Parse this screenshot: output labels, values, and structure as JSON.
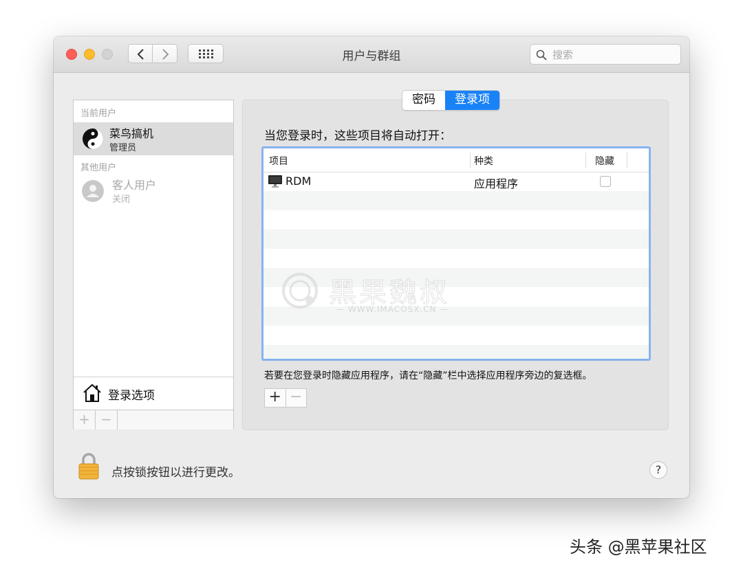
{
  "window": {
    "title": "用户与群组",
    "search": {
      "placeholder": "搜索",
      "value": ""
    }
  },
  "sidebar": {
    "current_users_label": "当前用户",
    "current_user": {
      "name": "菜鸟搞机",
      "role": "管理员"
    },
    "other_users_label": "其他用户",
    "other_users": [
      {
        "name": "客人用户",
        "status": "关闭"
      }
    ],
    "login_options_label": "登录选项",
    "toolbar": {
      "add": "+",
      "remove": "−"
    }
  },
  "tabs": [
    {
      "label": "密码",
      "active": false
    },
    {
      "label": "登录项",
      "active": true
    }
  ],
  "login_items": {
    "intro": "当您登录时，这些项目将自动打开：",
    "columns": [
      "项目",
      "种类",
      "隐藏"
    ],
    "rows": [
      {
        "item": "RDM",
        "kind": "应用程序",
        "hidden": false
      }
    ],
    "hint": "若要在您登录时隐藏应用程序，请在“隐藏”栏中选择应用程序旁边的复选框。",
    "add": "+",
    "remove": "−"
  },
  "footer": {
    "lock_text": "点按锁按钮以进行更改。",
    "help": "?"
  },
  "watermark": {
    "text": "黑果魏叔",
    "url": "— WWW.IMACOSX.CN —"
  },
  "credit": "头条 @黑苹果社区",
  "colors": {
    "accent": "#1a82f7",
    "table_focus": "#86b4ef",
    "close": "#fc5f57",
    "minimize": "#fdbc2e"
  }
}
